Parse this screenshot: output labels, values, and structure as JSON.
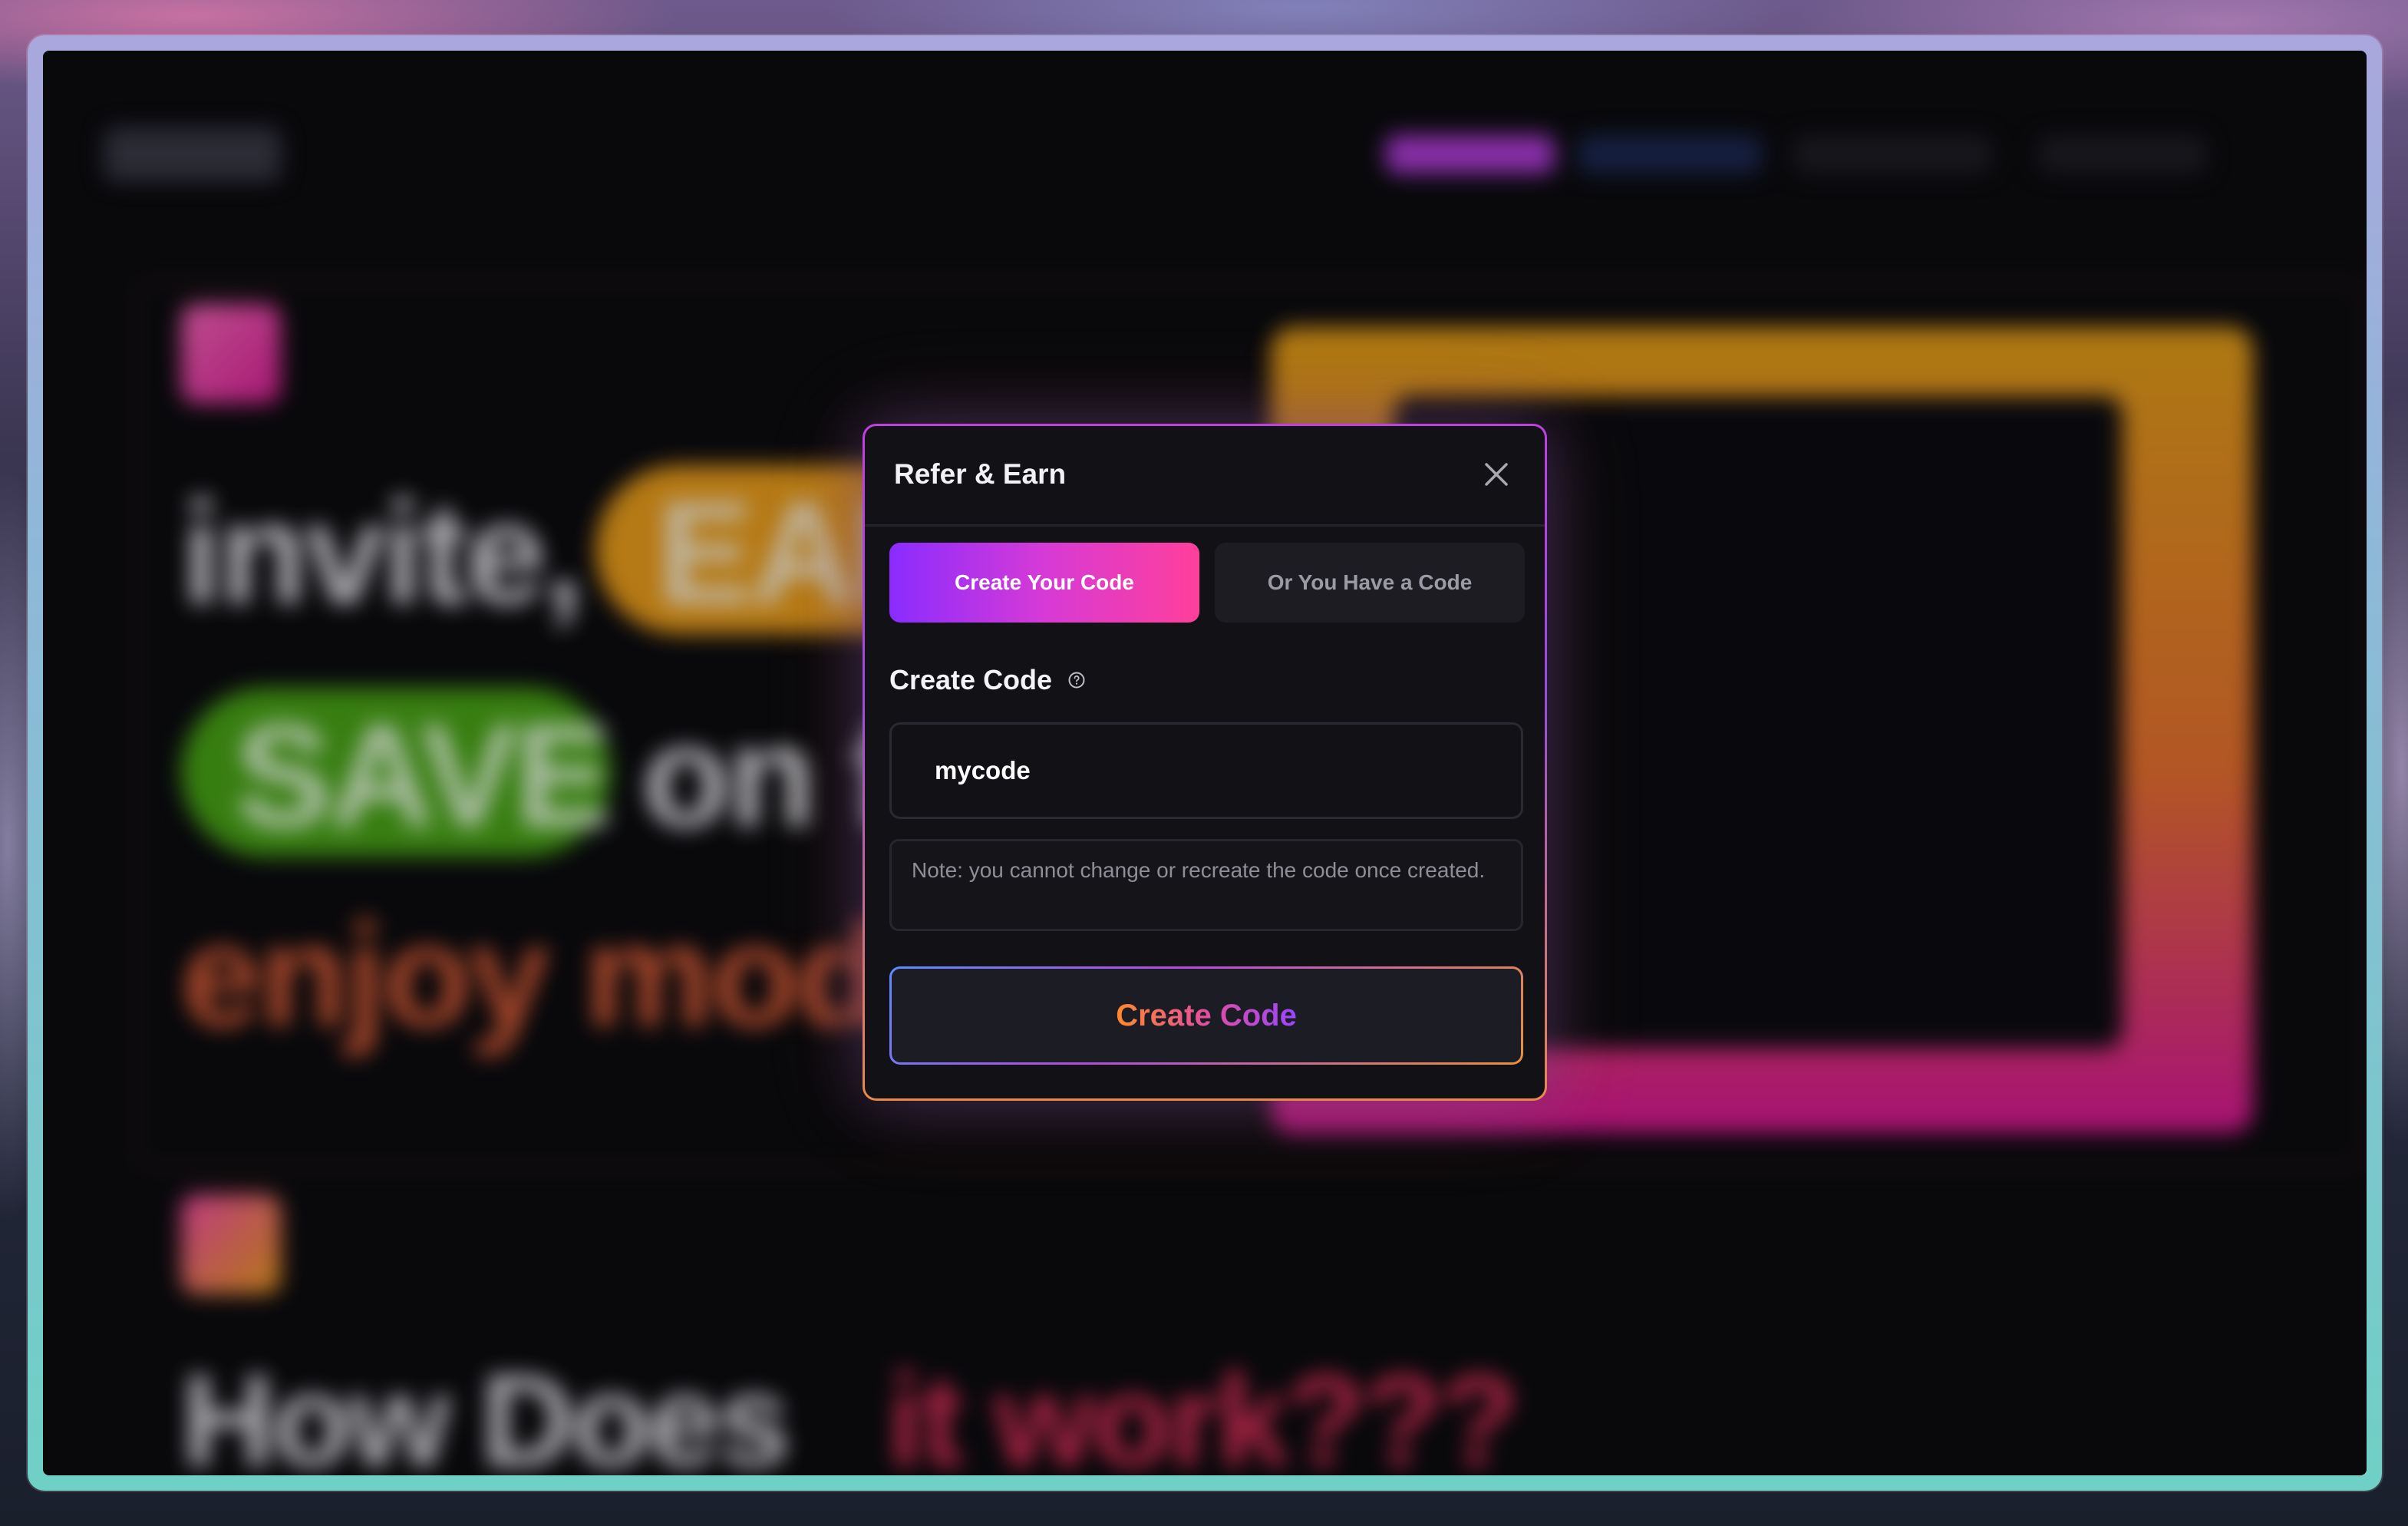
{
  "modal": {
    "title": "Refer & Earn",
    "close_icon": "close-icon",
    "tabs": [
      {
        "label": "Create Your Code",
        "active": true
      },
      {
        "label": "Or You Have a Code",
        "active": false
      }
    ],
    "section_label": "Create Code",
    "help_icon": "help-circle-icon",
    "code_input": {
      "value": "mycode",
      "placeholder": ""
    },
    "note": "Note: you cannot change or recreate the code once created.",
    "submit_label": "Create Code"
  },
  "background_page": {
    "hero_words": [
      "invite,",
      "EARN",
      "SAVE",
      "on f",
      "enjoy mod"
    ],
    "section_heading_a": "How Does",
    "section_heading_b": "it work???"
  },
  "colors": {
    "tab_gradient": [
      "#8a2cff",
      "#ff3f9a"
    ],
    "submit_text_gradient": [
      "#ff8a2a",
      "#9a46ff"
    ],
    "modal_bg": "#111116"
  }
}
